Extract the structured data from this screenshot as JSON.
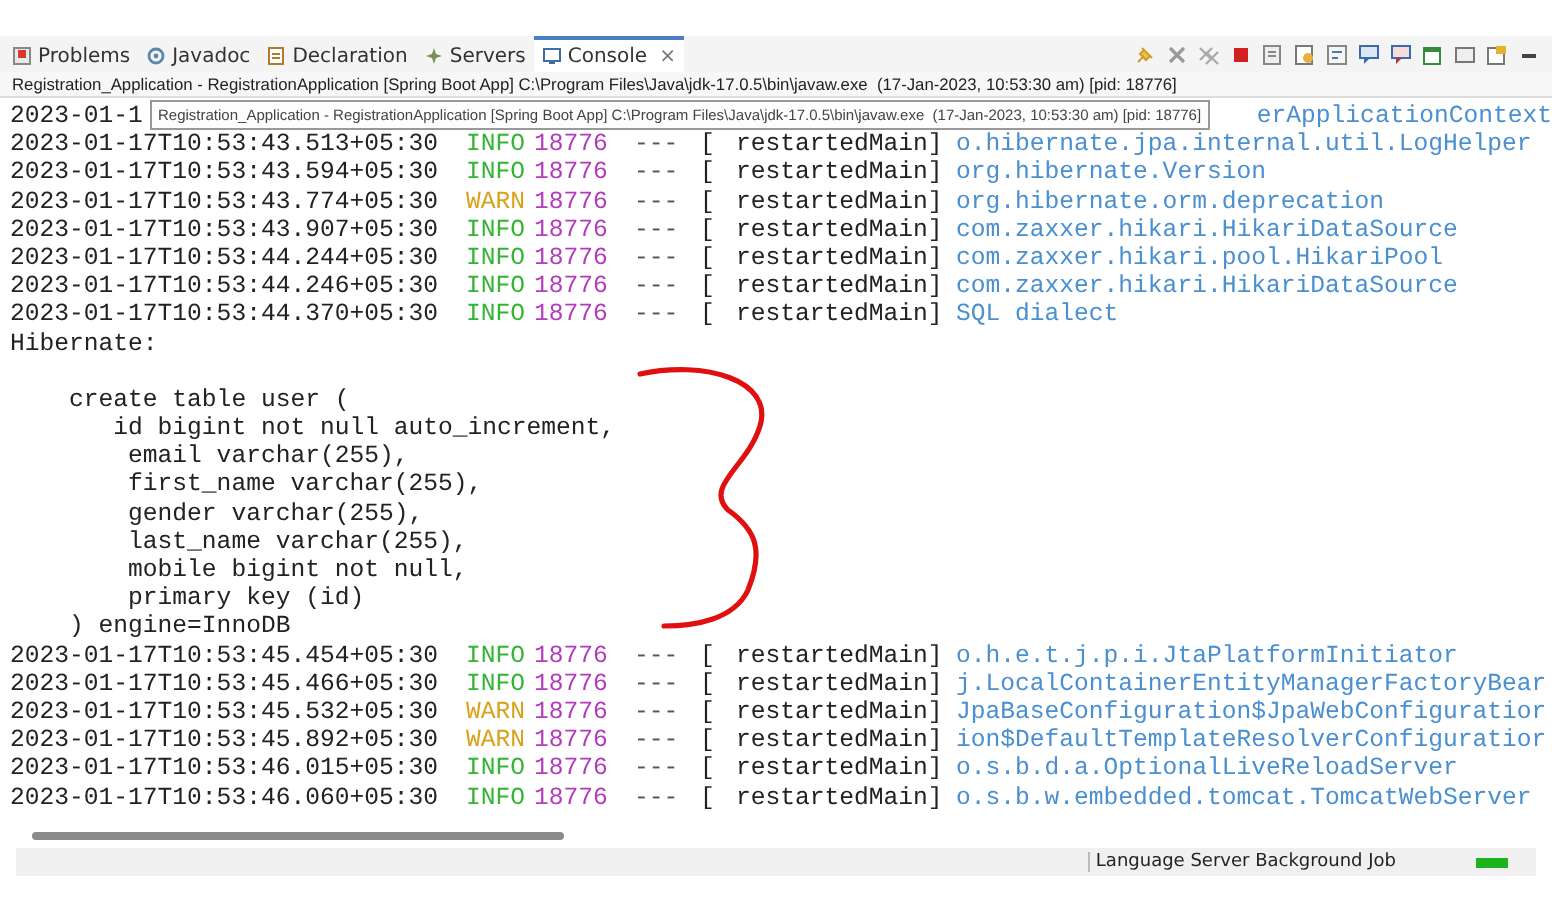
{
  "tabs": [
    {
      "label": "Problems",
      "selected": false
    },
    {
      "label": "Javadoc",
      "selected": false
    },
    {
      "label": "Declaration",
      "selected": false
    },
    {
      "label": "Servers",
      "selected": false
    },
    {
      "label": "Console",
      "selected": true,
      "close": "×"
    }
  ],
  "console_title": "Registration_Application - RegistrationApplication [Spring Boot App] C:\\Program Files\\Java\\jdk-17.0.5\\bin\\javaw.exe  (17-Jan-2023, 10:53:30 am) [pid: 18776]",
  "tooltip": "Registration_Application - RegistrationApplication [Spring Boot App] C:\\Program Files\\Java\\jdk-17.0.5\\bin\\javaw.exe  (17-Jan-2023, 10:53:30 am) [pid: 18776]",
  "lines": [
    {
      "kind": "obscured",
      "timestamp": "2023-01-1",
      "logger": "erApplicationContext"
    },
    {
      "kind": "log",
      "timestamp": "2023-01-17T10:53:43.513+05:30",
      "level": "INFO",
      "color": "#33b533",
      "pid": "18776",
      "sep": "---",
      "bracket": "[",
      "thread": "restartedMain]",
      "logger": "o.hibernate.jpa.internal.util.LogHelper"
    },
    {
      "kind": "log",
      "timestamp": "2023-01-17T10:53:43.594+05:30",
      "level": "INFO",
      "color": "#33b533",
      "pid": "18776",
      "sep": "---",
      "bracket": "[",
      "thread": "restartedMain]",
      "logger": "org.hibernate.Version"
    },
    {
      "kind": "log",
      "timestamp": "2023-01-17T10:53:43.774+05:30",
      "level": "WARN",
      "color": "#d9a21b",
      "pid": "18776",
      "sep": "---",
      "bracket": "[",
      "thread": "restartedMain]",
      "logger": "org.hibernate.orm.deprecation"
    },
    {
      "kind": "log",
      "timestamp": "2023-01-17T10:53:43.907+05:30",
      "level": "INFO",
      "color": "#33b533",
      "pid": "18776",
      "sep": "---",
      "bracket": "[",
      "thread": "restartedMain]",
      "logger": "com.zaxxer.hikari.HikariDataSource"
    },
    {
      "kind": "log",
      "timestamp": "2023-01-17T10:53:44.244+05:30",
      "level": "INFO",
      "color": "#33b533",
      "pid": "18776",
      "sep": "---",
      "bracket": "[",
      "thread": "restartedMain]",
      "logger": "com.zaxxer.hikari.pool.HikariPool"
    },
    {
      "kind": "log",
      "timestamp": "2023-01-17T10:53:44.246+05:30",
      "level": "INFO",
      "color": "#33b533",
      "pid": "18776",
      "sep": "---",
      "bracket": "[",
      "thread": "restartedMain]",
      "logger": "com.zaxxer.hikari.HikariDataSource"
    },
    {
      "kind": "log",
      "timestamp": "2023-01-17T10:53:44.370+05:30",
      "level": "INFO",
      "color": "#33b533",
      "pid": "18776",
      "sep": "---",
      "bracket": "[",
      "thread": "restartedMain]",
      "logger": "SQL dialect"
    },
    {
      "kind": "plain",
      "text": "Hibernate:"
    },
    {
      "kind": "blank"
    },
    {
      "kind": "plain",
      "text": "    create table user ("
    },
    {
      "kind": "plain",
      "text": "       id bigint not null auto_increment,"
    },
    {
      "kind": "plain",
      "text": "        email varchar(255),"
    },
    {
      "kind": "plain",
      "text": "        first_name varchar(255),"
    },
    {
      "kind": "plain",
      "text": "        gender varchar(255),"
    },
    {
      "kind": "plain",
      "text": "        last_name varchar(255),"
    },
    {
      "kind": "plain",
      "text": "        mobile bigint not null,"
    },
    {
      "kind": "plain",
      "text": "        primary key (id)"
    },
    {
      "kind": "plain",
      "text": "    ) engine=InnoDB"
    },
    {
      "kind": "log",
      "timestamp": "2023-01-17T10:53:45.454+05:30",
      "level": "INFO",
      "color": "#33b533",
      "pid": "18776",
      "sep": "---",
      "bracket": "[",
      "thread": "restartedMain]",
      "logger": "o.h.e.t.j.p.i.JtaPlatformInitiator"
    },
    {
      "kind": "log",
      "timestamp": "2023-01-17T10:53:45.466+05:30",
      "level": "INFO",
      "color": "#33b533",
      "pid": "18776",
      "sep": "---",
      "bracket": "[",
      "thread": "restartedMain]",
      "logger": "j.LocalContainerEntityManagerFactoryBear"
    },
    {
      "kind": "log",
      "timestamp": "2023-01-17T10:53:45.532+05:30",
      "level": "WARN",
      "color": "#d9a21b",
      "pid": "18776",
      "sep": "---",
      "bracket": "[",
      "thread": "restartedMain]",
      "logger": "JpaBaseConfiguration$JpaWebConfiguratior"
    },
    {
      "kind": "log",
      "timestamp": "2023-01-17T10:53:45.892+05:30",
      "level": "WARN",
      "color": "#d9a21b",
      "pid": "18776",
      "sep": "---",
      "bracket": "[",
      "thread": "restartedMain]",
      "logger": "ion$DefaultTemplateResolverConfiguratior"
    },
    {
      "kind": "log",
      "timestamp": "2023-01-17T10:53:46.015+05:30",
      "level": "INFO",
      "color": "#33b533",
      "pid": "18776",
      "sep": "---",
      "bracket": "[",
      "thread": "restartedMain]",
      "logger": "o.s.b.d.a.OptionalLiveReloadServer"
    },
    {
      "kind": "log",
      "timestamp": "2023-01-17T10:53:46.060+05:30",
      "level": "INFO",
      "color": "#33b533",
      "pid": "18776",
      "sep": "---",
      "bracket": "[",
      "thread": "restartedMain]",
      "logger": "o.s.b.w.embedded.tomcat.TomcatWebServer"
    }
  ],
  "status_bar": {
    "job": "Language Server Background Job",
    "level": 1
  }
}
